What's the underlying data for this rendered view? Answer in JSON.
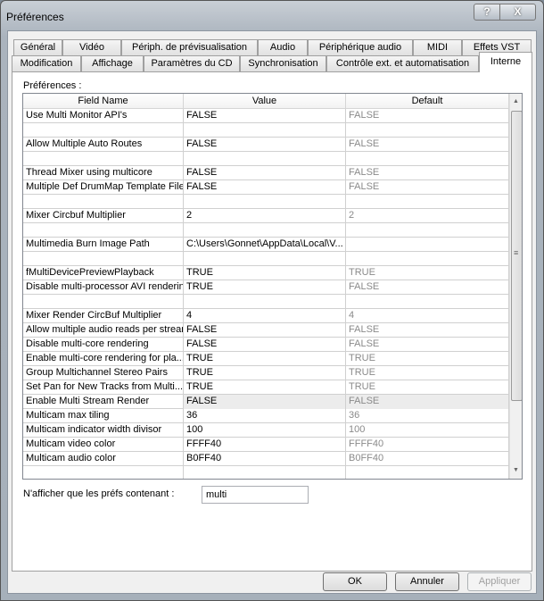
{
  "window": {
    "title": "Préférences",
    "help_label": "?",
    "close_label": "X"
  },
  "tabs_row1": [
    "Général",
    "Vidéo",
    "Périph. de prévisualisation",
    "Audio",
    "Périphérique audio",
    "MIDI",
    "Effets VST"
  ],
  "tabs_row2": [
    "Modification",
    "Affichage",
    "Paramètres du CD",
    "Synchronisation",
    "Contrôle ext. et automatisation",
    "Interne"
  ],
  "active_tab": "Interne",
  "panel": {
    "label": "Préférences :"
  },
  "table": {
    "columns": [
      "Field Name",
      "Value",
      "Default"
    ],
    "rows": [
      [
        "Use Multi Monitor API's",
        "FALSE",
        "FALSE"
      ],
      [
        "",
        "",
        ""
      ],
      [
        "Allow Multiple Auto Routes",
        "FALSE",
        "FALSE"
      ],
      [
        "",
        "",
        ""
      ],
      [
        "Thread Mixer using multicore",
        "FALSE",
        "FALSE"
      ],
      [
        "Multiple Def DrumMap Template Files",
        "FALSE",
        "FALSE"
      ],
      [
        "",
        "",
        ""
      ],
      [
        "Mixer Circbuf Multiplier",
        "2",
        "2"
      ],
      [
        "",
        "",
        ""
      ],
      [
        "Multimedia Burn Image Path",
        "C:\\Users\\Gonnet\\AppData\\Local\\V...",
        ""
      ],
      [
        "",
        "",
        ""
      ],
      [
        "fMultiDevicePreviewPlayback",
        "TRUE",
        "TRUE"
      ],
      [
        "Disable multi-processor AVI rendering",
        "TRUE",
        "FALSE"
      ],
      [
        "",
        "",
        ""
      ],
      [
        "Mixer Render CircBuf Multiplier",
        "4",
        "4"
      ],
      [
        "Allow multiple audio reads per stream",
        "FALSE",
        "FALSE"
      ],
      [
        "Disable multi-core rendering",
        "FALSE",
        "FALSE"
      ],
      [
        "Enable multi-core rendering for pla...",
        "TRUE",
        "TRUE"
      ],
      [
        "Group Multichannel Stereo Pairs",
        "TRUE",
        "TRUE"
      ],
      [
        "Set Pan for New Tracks from Multi...",
        "TRUE",
        "TRUE"
      ],
      [
        "Enable Multi Stream Render",
        "FALSE",
        "FALSE"
      ],
      [
        "Multicam max tiling",
        "36",
        "36"
      ],
      [
        "Multicam indicator width divisor",
        "100",
        "100"
      ],
      [
        "Multicam video color",
        "FFFF40",
        "FFFF40"
      ],
      [
        "Multicam audio color",
        "B0FF40",
        "B0FF40"
      ],
      [
        "",
        "",
        ""
      ]
    ],
    "highlighted_row": 20
  },
  "filter": {
    "label": "N'afficher que les préfs contenant :",
    "value": "multi"
  },
  "buttons": {
    "ok": "OK",
    "cancel": "Annuler",
    "apply": "Appliquer"
  }
}
